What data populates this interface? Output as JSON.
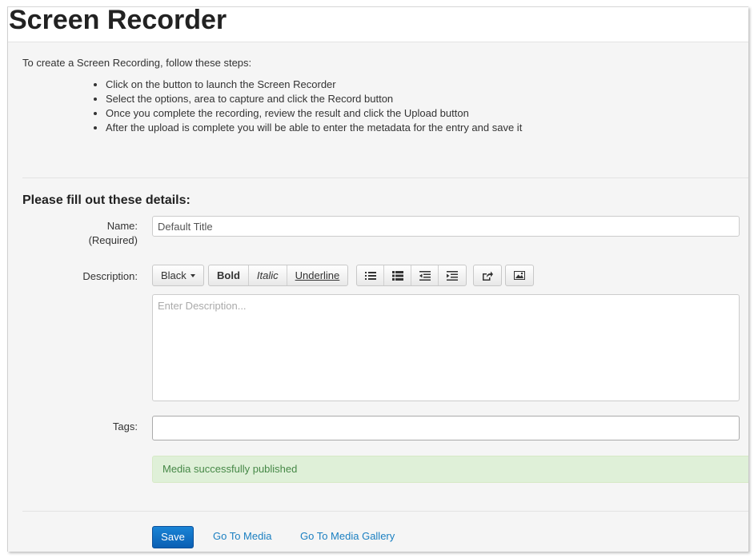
{
  "page": {
    "title": "Screen Recorder"
  },
  "instructions": {
    "intro": "To create a Screen Recording, follow these steps:",
    "steps": [
      "Click on the button to launch the Screen Recorder",
      "Select the options, area to capture and click the Record button",
      "Once you complete the recording, review the result and click the Upload button",
      "After the upload is complete you will be able to enter the metadata for the entry and save it"
    ]
  },
  "form": {
    "section_title": "Please fill out these details:",
    "name_label": "Name:",
    "name_required": "(Required)",
    "name_value": "Default Title",
    "description_label": "Description:",
    "description_placeholder": "Enter Description...",
    "tags_label": "Tags:",
    "tags_value": ""
  },
  "editor_toolbar": {
    "color_label": "Black",
    "bold_label": "Bold",
    "italic_label": "Italic",
    "underline_label": "Underline",
    "icons": [
      "unordered-list-icon",
      "ordered-list-icon",
      "outdent-icon",
      "indent-icon",
      "link-icon",
      "image-icon"
    ]
  },
  "alert": {
    "message": "Media successfully published",
    "color": "#468847",
    "background": "#dff0d8"
  },
  "actions": {
    "save_label": "Save",
    "go_to_media_label": "Go To Media",
    "go_to_gallery_label": "Go To Media Gallery"
  },
  "colors": {
    "primary": "#0a6cc4",
    "link": "#1a7fc1"
  }
}
